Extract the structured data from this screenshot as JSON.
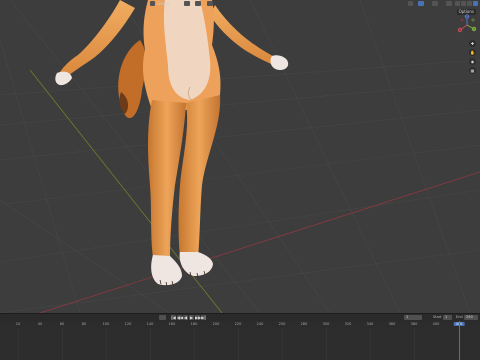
{
  "header": {
    "transform_orientation": "Global",
    "options_label": "Options"
  },
  "gizmo": {
    "x_label": "X",
    "y_label": "Y",
    "z_label": "Z"
  },
  "nav": [
    "✚",
    "✋",
    "◉",
    "▦"
  ],
  "timeline": {
    "playback_icons": [
      "|◀",
      "◀◀",
      "◀",
      "▶",
      "▶▶",
      "▶|"
    ],
    "current_frame": "1",
    "start_label": "Start",
    "start_value": "1",
    "end_label": "End",
    "end_value": "250",
    "ticks": [
      "10",
      "40",
      "60",
      "80",
      "100",
      "120",
      "140",
      "160",
      "180",
      "200",
      "220",
      "240",
      "250",
      "280",
      "300",
      "320",
      "340",
      "360",
      "380",
      "400"
    ],
    "current_tick": "400"
  },
  "colors": {
    "accent": "#4772b3",
    "viewport_bg": "#3d3d3d",
    "body_fur": "#e69a4a",
    "belly_fur": "#f0d6c0",
    "paw_white": "#efe6e2"
  }
}
